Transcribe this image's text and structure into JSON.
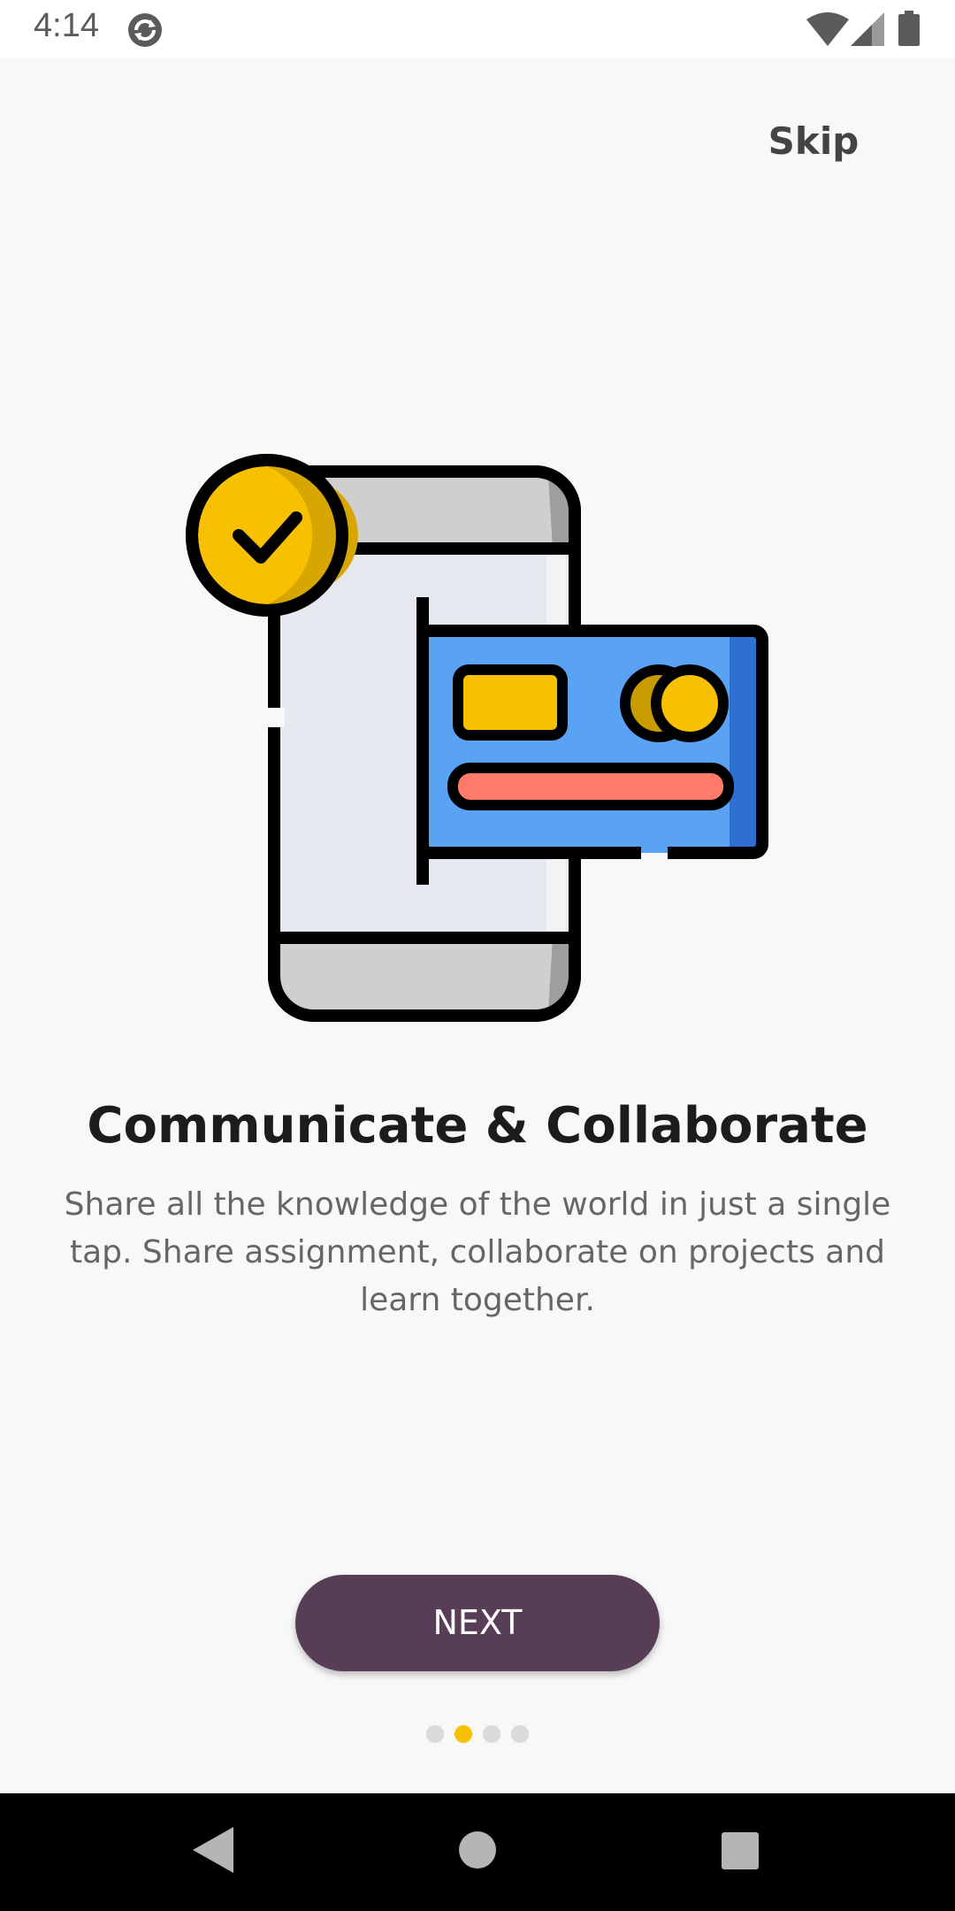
{
  "status_bar": {
    "time": "4:14",
    "icons": [
      "sync-icon",
      "wifi-icon",
      "signal-icon",
      "battery-icon"
    ]
  },
  "onboarding": {
    "skip_label": "Skip",
    "illustration": "phone-card-payment-check-illustration",
    "title": "Communicate & Collaborate",
    "description": "Share all the knowledge of the world in just a single tap. Share assignment, collaborate on projects and learn together.",
    "next_label": "NEXT",
    "page_indicator": {
      "total": 4,
      "current": 2
    }
  },
  "nav_bar": {
    "icons": [
      "back-icon",
      "home-icon",
      "recents-icon"
    ]
  },
  "colors": {
    "background": "#f8f8f8",
    "button": "#573d55",
    "accent": "#f7c000",
    "card_blue": "#5aa2f3",
    "card_stripe": "#ff7a6a"
  }
}
